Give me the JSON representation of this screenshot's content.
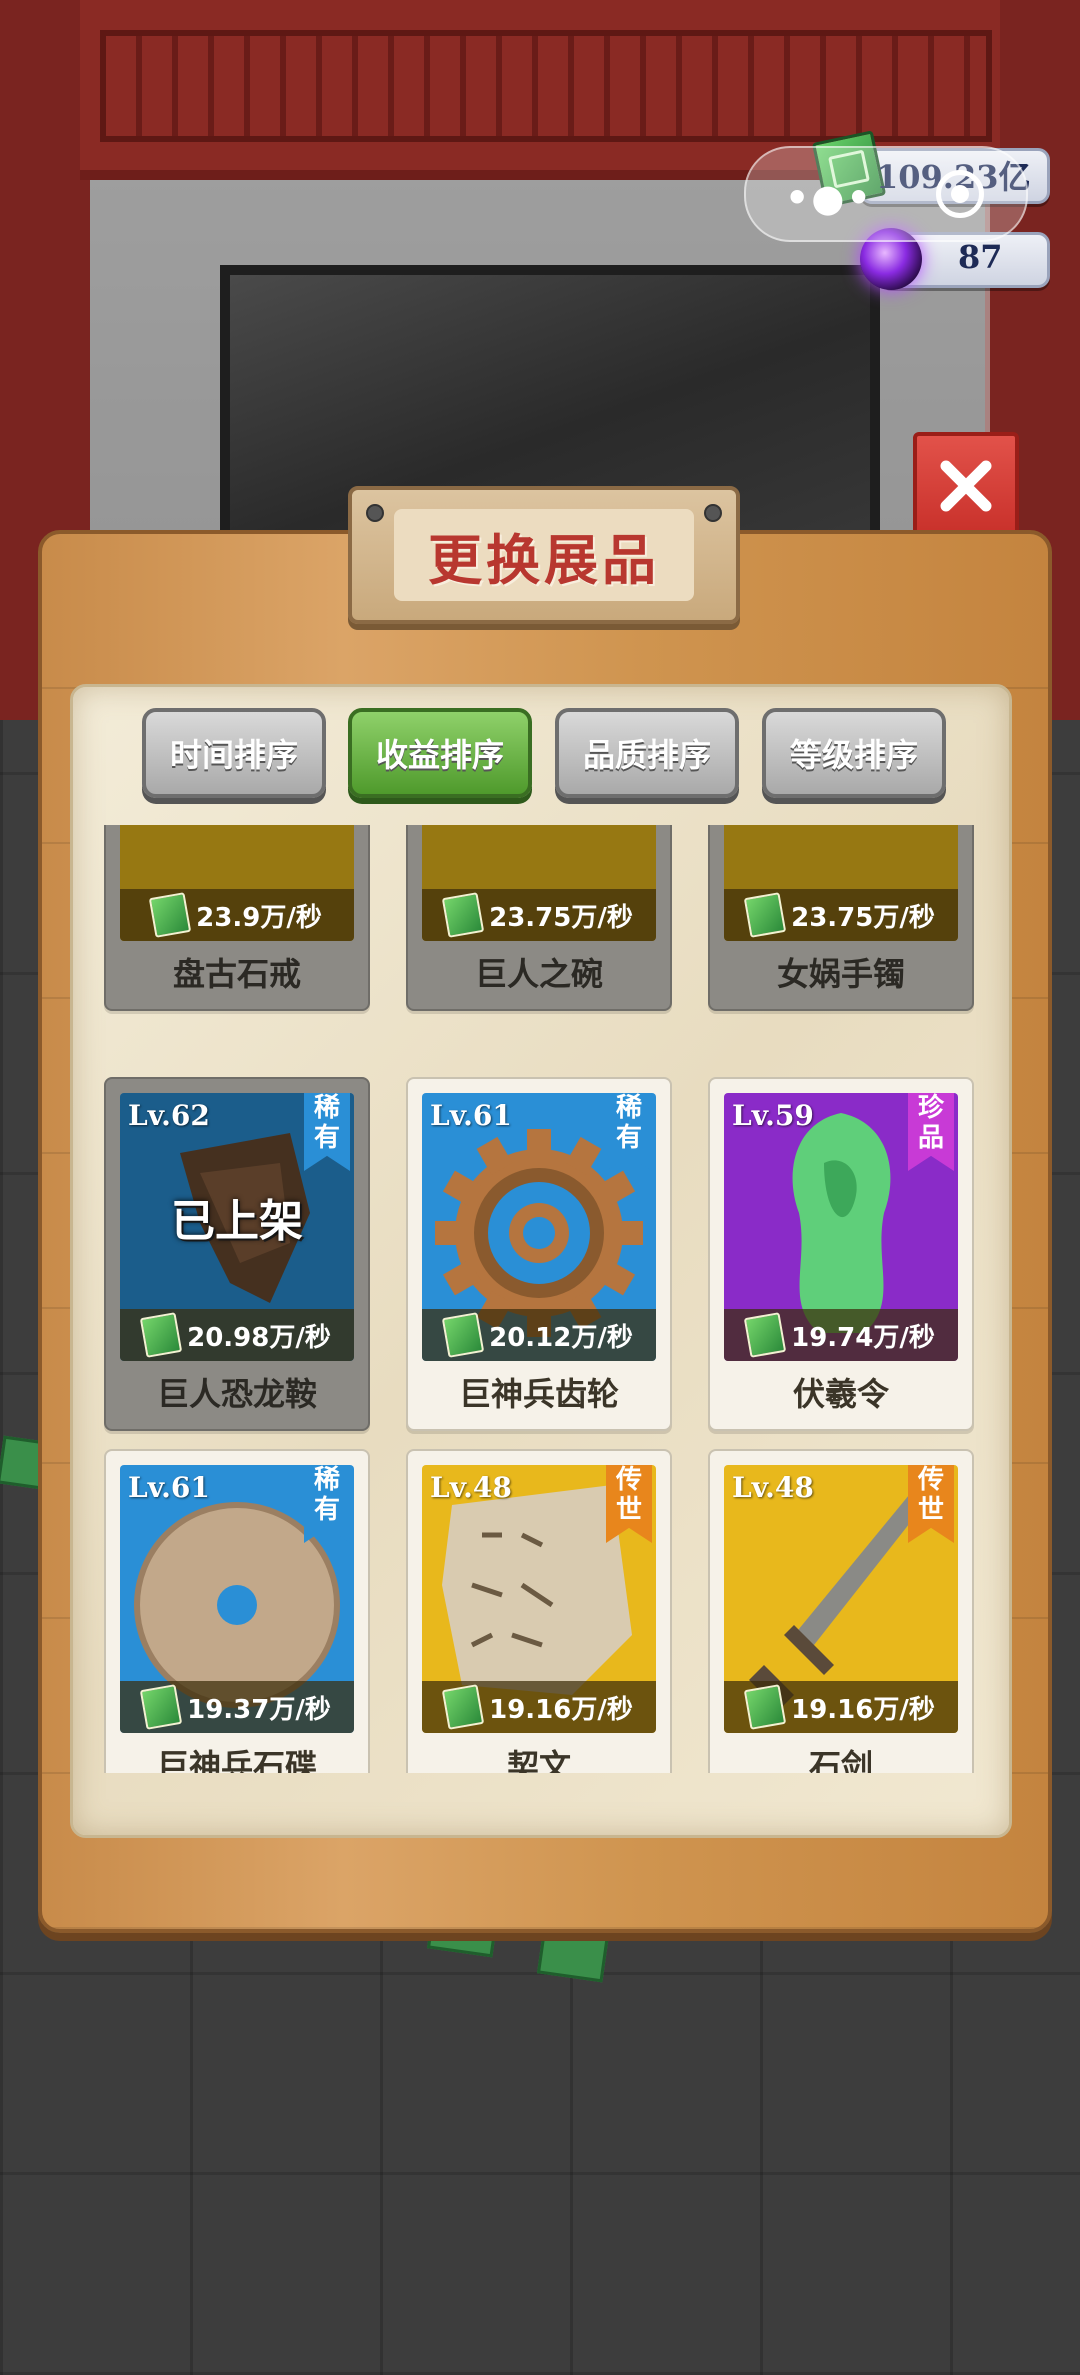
{
  "hud": {
    "cash_value": "109.23亿",
    "orb_value": "87"
  },
  "dialog": {
    "title": "更换展品"
  },
  "sort_tabs": [
    {
      "label": "时间排序",
      "active": false
    },
    {
      "label": "收益排序",
      "active": true
    },
    {
      "label": "品质排序",
      "active": false
    },
    {
      "label": "等级排序",
      "active": false
    }
  ],
  "shelved_label": "已上架",
  "items": [
    {
      "name": "盘古石戒",
      "income": "23.9万/秒",
      "shelved": true,
      "bg": "#e8b81c"
    },
    {
      "name": "巨人之碗",
      "income": "23.75万/秒",
      "shelved": true,
      "bg": "#e8b81c"
    },
    {
      "name": "女娲手镯",
      "income": "23.75万/秒",
      "shelved": true,
      "bg": "#e8b81c"
    },
    {
      "name": "巨人恐龙鞍",
      "level": "Lv.62",
      "rarity": "稀有",
      "income": "20.98万/秒",
      "shelved": true,
      "bg": "#2a8fd6",
      "rarity_color": "#2a8fd6"
    },
    {
      "name": "巨神兵齿轮",
      "level": "Lv.61",
      "rarity": "稀有",
      "income": "20.12万/秒",
      "shelved": false,
      "bg": "#2a8fd6",
      "rarity_color": "#2a8fd6"
    },
    {
      "name": "伏羲令",
      "level": "Lv.59",
      "rarity": "珍品",
      "income": "19.74万/秒",
      "shelved": false,
      "bg": "#8a2bc8",
      "rarity_color": "#c83ad6"
    },
    {
      "name": "巨神兵石碟",
      "level": "Lv.61",
      "rarity": "稀有",
      "income": "19.37万/秒",
      "shelved": false,
      "bg": "#2a8fd6",
      "rarity_color": "#2a8fd6"
    },
    {
      "name": "契文",
      "level": "Lv.48",
      "rarity": "传世",
      "income": "19.16万/秒",
      "shelved": false,
      "bg": "#e8b81c",
      "rarity_color": "#e8861c"
    },
    {
      "name": "石剑",
      "level": "Lv.48",
      "rarity": "传世",
      "income": "19.16万/秒",
      "shelved": false,
      "bg": "#e8b81c",
      "rarity_color": "#e8861c"
    }
  ]
}
